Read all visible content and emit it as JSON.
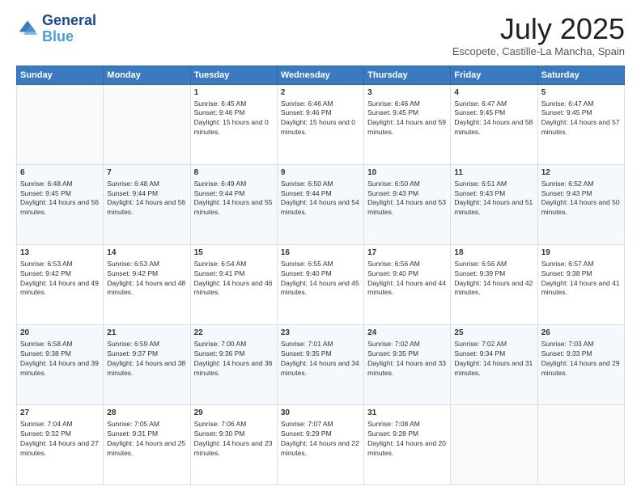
{
  "header": {
    "logo_line1": "General",
    "logo_line2": "Blue",
    "title": "July 2025",
    "subtitle": "Escopete, Castille-La Mancha, Spain"
  },
  "weekdays": [
    "Sunday",
    "Monday",
    "Tuesday",
    "Wednesday",
    "Thursday",
    "Friday",
    "Saturday"
  ],
  "weeks": [
    [
      {
        "day": "",
        "info": ""
      },
      {
        "day": "",
        "info": ""
      },
      {
        "day": "1",
        "info": "Sunrise: 6:45 AM\nSunset: 9:46 PM\nDaylight: 15 hours and 0 minutes."
      },
      {
        "day": "2",
        "info": "Sunrise: 6:46 AM\nSunset: 9:46 PM\nDaylight: 15 hours and 0 minutes."
      },
      {
        "day": "3",
        "info": "Sunrise: 6:46 AM\nSunset: 9:45 PM\nDaylight: 14 hours and 59 minutes."
      },
      {
        "day": "4",
        "info": "Sunrise: 6:47 AM\nSunset: 9:45 PM\nDaylight: 14 hours and 58 minutes."
      },
      {
        "day": "5",
        "info": "Sunrise: 6:47 AM\nSunset: 9:45 PM\nDaylight: 14 hours and 57 minutes."
      }
    ],
    [
      {
        "day": "6",
        "info": "Sunrise: 6:48 AM\nSunset: 9:45 PM\nDaylight: 14 hours and 56 minutes."
      },
      {
        "day": "7",
        "info": "Sunrise: 6:48 AM\nSunset: 9:44 PM\nDaylight: 14 hours and 56 minutes."
      },
      {
        "day": "8",
        "info": "Sunrise: 6:49 AM\nSunset: 9:44 PM\nDaylight: 14 hours and 55 minutes."
      },
      {
        "day": "9",
        "info": "Sunrise: 6:50 AM\nSunset: 9:44 PM\nDaylight: 14 hours and 54 minutes."
      },
      {
        "day": "10",
        "info": "Sunrise: 6:50 AM\nSunset: 9:43 PM\nDaylight: 14 hours and 53 minutes."
      },
      {
        "day": "11",
        "info": "Sunrise: 6:51 AM\nSunset: 9:43 PM\nDaylight: 14 hours and 51 minutes."
      },
      {
        "day": "12",
        "info": "Sunrise: 6:52 AM\nSunset: 9:43 PM\nDaylight: 14 hours and 50 minutes."
      }
    ],
    [
      {
        "day": "13",
        "info": "Sunrise: 6:53 AM\nSunset: 9:42 PM\nDaylight: 14 hours and 49 minutes."
      },
      {
        "day": "14",
        "info": "Sunrise: 6:53 AM\nSunset: 9:42 PM\nDaylight: 14 hours and 48 minutes."
      },
      {
        "day": "15",
        "info": "Sunrise: 6:54 AM\nSunset: 9:41 PM\nDaylight: 14 hours and 46 minutes."
      },
      {
        "day": "16",
        "info": "Sunrise: 6:55 AM\nSunset: 9:40 PM\nDaylight: 14 hours and 45 minutes."
      },
      {
        "day": "17",
        "info": "Sunrise: 6:56 AM\nSunset: 9:40 PM\nDaylight: 14 hours and 44 minutes."
      },
      {
        "day": "18",
        "info": "Sunrise: 6:56 AM\nSunset: 9:39 PM\nDaylight: 14 hours and 42 minutes."
      },
      {
        "day": "19",
        "info": "Sunrise: 6:57 AM\nSunset: 9:38 PM\nDaylight: 14 hours and 41 minutes."
      }
    ],
    [
      {
        "day": "20",
        "info": "Sunrise: 6:58 AM\nSunset: 9:38 PM\nDaylight: 14 hours and 39 minutes."
      },
      {
        "day": "21",
        "info": "Sunrise: 6:59 AM\nSunset: 9:37 PM\nDaylight: 14 hours and 38 minutes."
      },
      {
        "day": "22",
        "info": "Sunrise: 7:00 AM\nSunset: 9:36 PM\nDaylight: 14 hours and 36 minutes."
      },
      {
        "day": "23",
        "info": "Sunrise: 7:01 AM\nSunset: 9:35 PM\nDaylight: 14 hours and 34 minutes."
      },
      {
        "day": "24",
        "info": "Sunrise: 7:02 AM\nSunset: 9:35 PM\nDaylight: 14 hours and 33 minutes."
      },
      {
        "day": "25",
        "info": "Sunrise: 7:02 AM\nSunset: 9:34 PM\nDaylight: 14 hours and 31 minutes."
      },
      {
        "day": "26",
        "info": "Sunrise: 7:03 AM\nSunset: 9:33 PM\nDaylight: 14 hours and 29 minutes."
      }
    ],
    [
      {
        "day": "27",
        "info": "Sunrise: 7:04 AM\nSunset: 9:32 PM\nDaylight: 14 hours and 27 minutes."
      },
      {
        "day": "28",
        "info": "Sunrise: 7:05 AM\nSunset: 9:31 PM\nDaylight: 14 hours and 25 minutes."
      },
      {
        "day": "29",
        "info": "Sunrise: 7:06 AM\nSunset: 9:30 PM\nDaylight: 14 hours and 23 minutes."
      },
      {
        "day": "30",
        "info": "Sunrise: 7:07 AM\nSunset: 9:29 PM\nDaylight: 14 hours and 22 minutes."
      },
      {
        "day": "31",
        "info": "Sunrise: 7:08 AM\nSunset: 9:28 PM\nDaylight: 14 hours and 20 minutes."
      },
      {
        "day": "",
        "info": ""
      },
      {
        "day": "",
        "info": ""
      }
    ]
  ]
}
